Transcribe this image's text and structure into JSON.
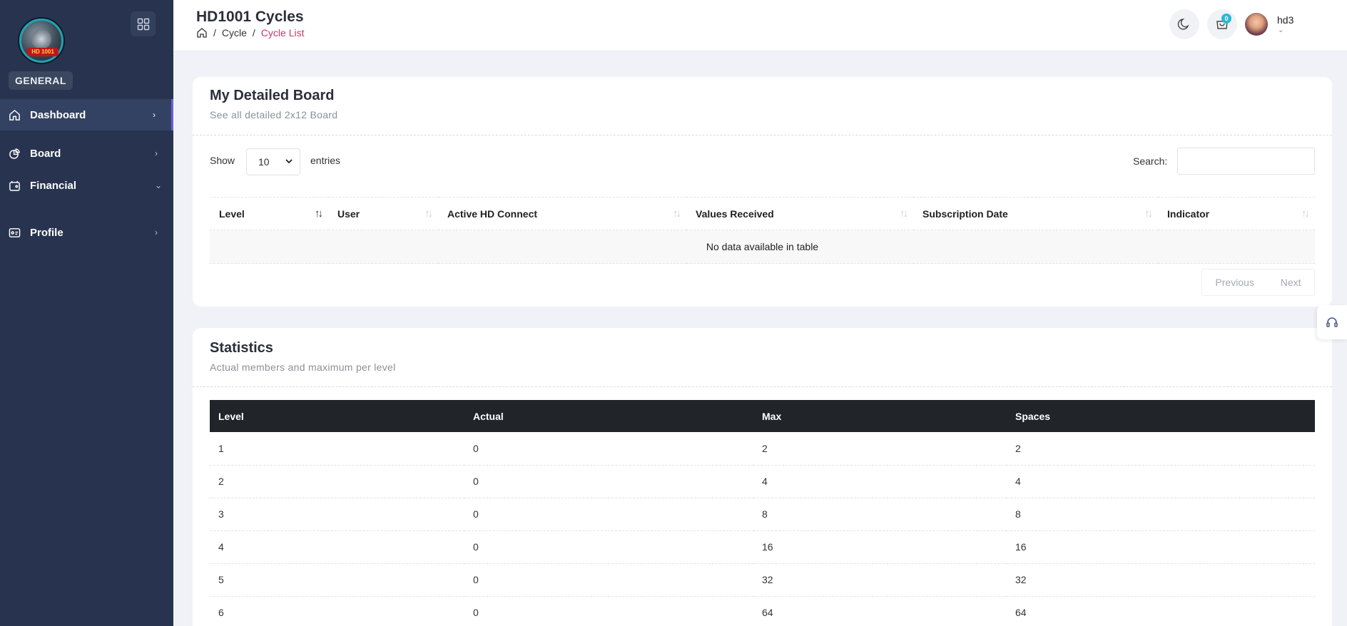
{
  "sidebar": {
    "logo_text": "HD 1001",
    "section_label": "GENERAL",
    "items": [
      {
        "label": "Dashboard",
        "icon": "home-icon"
      },
      {
        "label": "Board",
        "icon": "pie-chart-icon"
      },
      {
        "label": "Financial",
        "icon": "wallet-icon"
      },
      {
        "label": "Profile",
        "icon": "id-card-icon"
      }
    ]
  },
  "header": {
    "title": "HD1001 Cycles",
    "breadcrumb": [
      "Cycle",
      "Cycle List"
    ],
    "separator": "/",
    "cart_count": "0",
    "username": "hd3"
  },
  "board": {
    "title": "My Detailed Board",
    "subtitle": "See all detailed 2x12 Board",
    "show_label": "Show",
    "entries_value": "10",
    "entries_label": "entries",
    "search_label": "Search:",
    "columns": [
      "Level",
      "User",
      "Active HD Connect",
      "Values Received",
      "Subscription Date",
      "Indicator"
    ],
    "empty_text": "No data available in table",
    "prev_label": "Previous",
    "next_label": "Next"
  },
  "statistics": {
    "title": "Statistics",
    "subtitle": "Actual members and maximum per level",
    "columns": [
      "Level",
      "Actual",
      "Max",
      "Spaces"
    ],
    "rows": [
      [
        "1",
        "0",
        "2",
        "2"
      ],
      [
        "2",
        "0",
        "4",
        "4"
      ],
      [
        "3",
        "0",
        "8",
        "8"
      ],
      [
        "4",
        "0",
        "16",
        "16"
      ],
      [
        "5",
        "0",
        "32",
        "32"
      ],
      [
        "6",
        "0",
        "64",
        "64"
      ]
    ]
  },
  "colors": {
    "sidebar_bg": "#28344f",
    "breadcrumb_active": "#c53a6a",
    "badge": "#26b8d8",
    "table_head": "#212529"
  }
}
